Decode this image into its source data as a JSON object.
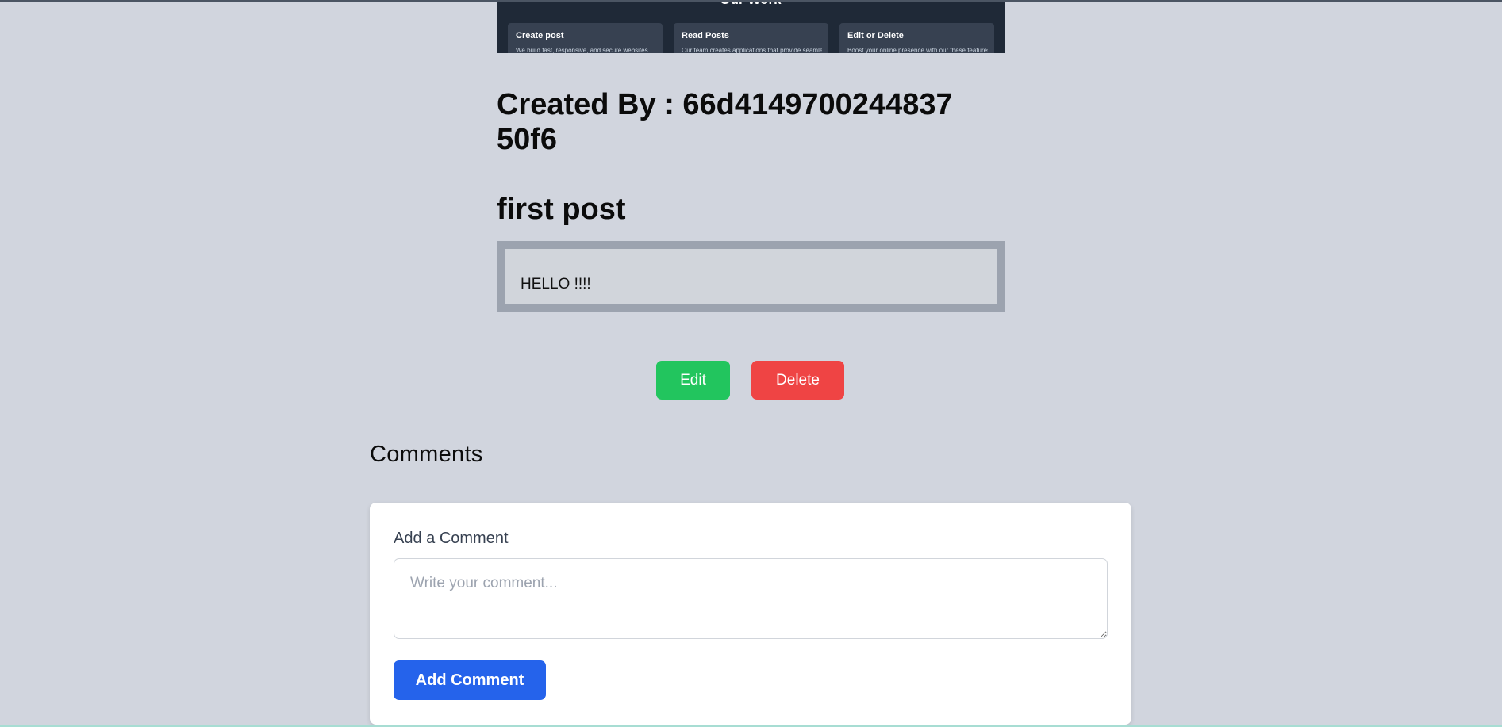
{
  "banner": {
    "title": "Our Work",
    "cards": [
      {
        "title": "Create post",
        "text": "We build fast, responsive, and secure websites"
      },
      {
        "title": "Read Posts",
        "text": "Our team creates applications that provide seamless"
      },
      {
        "title": "Edit or Delete",
        "text": "Boost your online presence with our these features."
      }
    ]
  },
  "post": {
    "created_by": "Created By : 66d4149700244837 50f6",
    "title": "first post",
    "body": "HELLO !!!!"
  },
  "actions": {
    "edit_label": "Edit",
    "delete_label": "Delete"
  },
  "comments": {
    "heading": "Comments",
    "form_label": "Add a Comment",
    "placeholder": "Write your comment...",
    "value": "",
    "submit_label": "Add Comment"
  },
  "colors": {
    "page_bg": "#d1d5de",
    "banner_bg": "#1f2937",
    "edit": "#22c55e",
    "delete": "#ef4444",
    "primary": "#2563eb"
  }
}
